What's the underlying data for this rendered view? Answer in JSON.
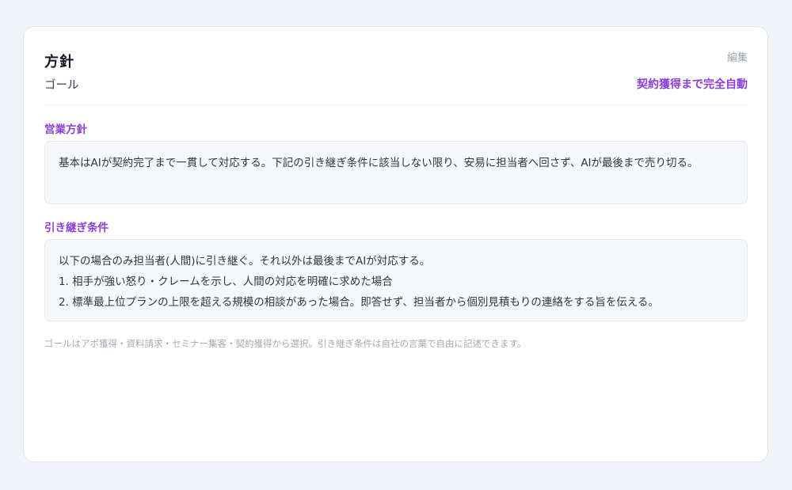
{
  "card": {
    "title": "方針",
    "edit_label": "編集",
    "goal_label": "ゴール",
    "goal_value": "契約獲得まで完全自動"
  },
  "sales_policy": {
    "label": "営業方針",
    "text": "基本はAIが契約完了まで一貫して対応する。下記の引き継ぎ条件に該当しない限り、安易に担当者へ回さず、AIが最後まで売り切る。"
  },
  "handover": {
    "label": "引き継ぎ条件",
    "lines": [
      "以下の場合のみ担当者(人間)に引き継ぐ。それ以外は最後までAIが対応する。",
      "1. 相手が強い怒り・クレームを示し、人間の対応を明確に求めた場合",
      "2. 標準最上位プランの上限を超える規模の相談があった場合。即答せず、担当者から個別見積もりの連絡をする旨を伝える。"
    ]
  },
  "footnote": "ゴールはアポ獲得・資料請求・セミナー集客・契約獲得から選択。引き継ぎ条件は自社の言葉で自由に記述できます。"
}
